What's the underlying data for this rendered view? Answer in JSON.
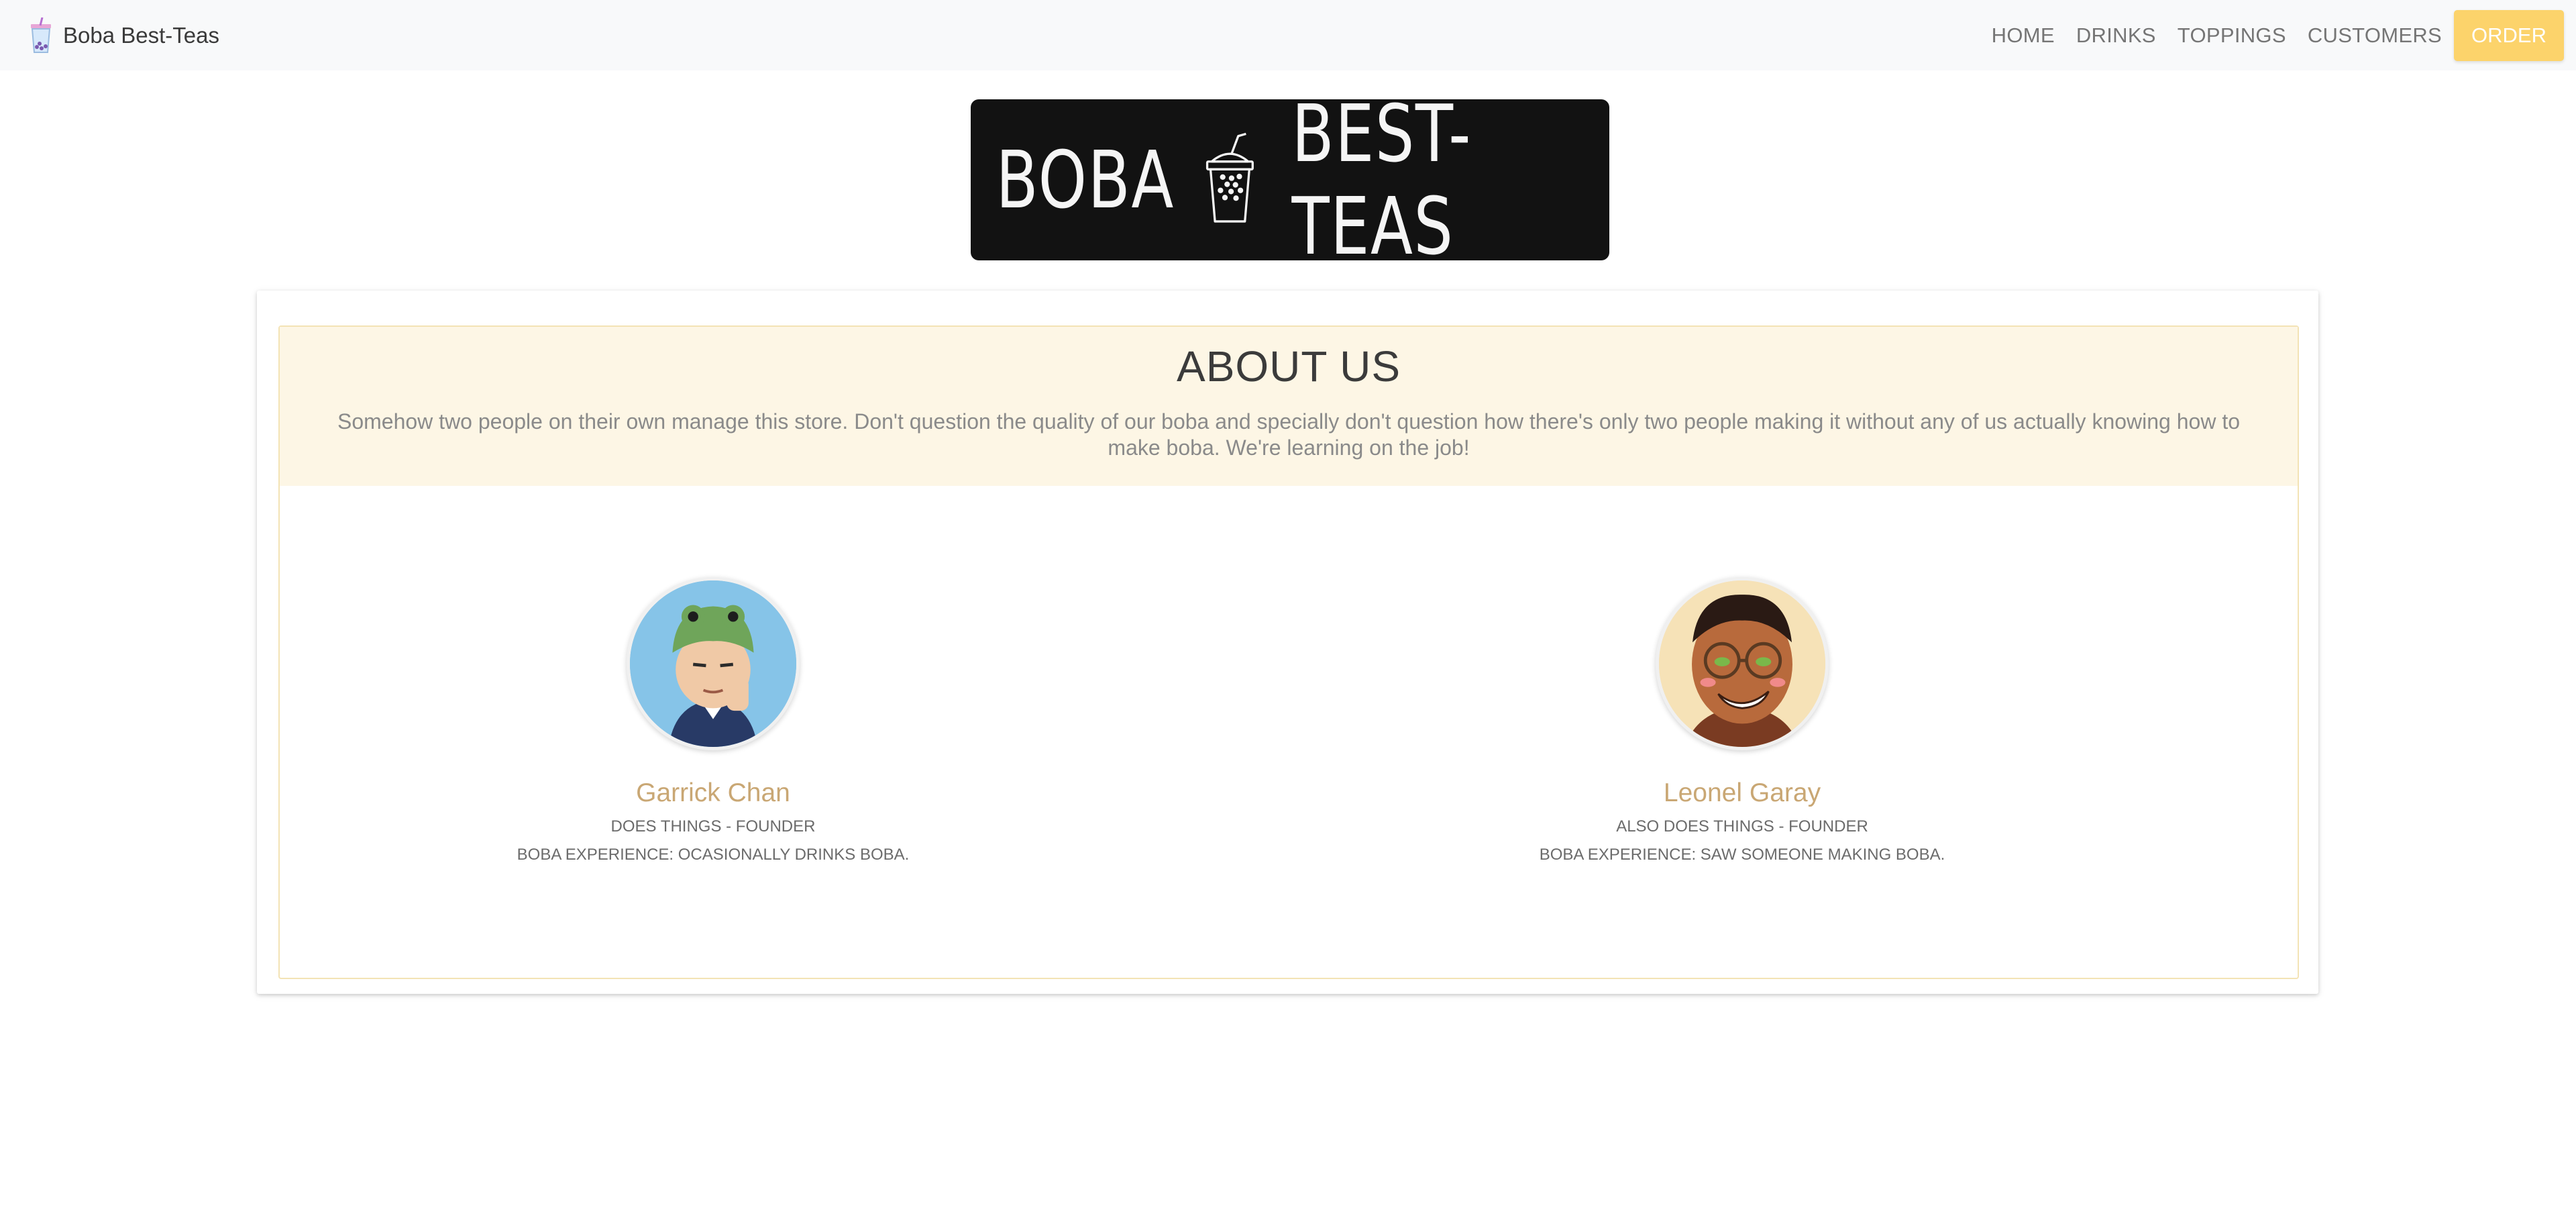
{
  "navbar": {
    "brand": "Boba Best-Teas",
    "brand_icon": "boba-cup-icon",
    "links": [
      "HOME",
      "DRINKS",
      "TOPPINGS",
      "CUSTOMERS"
    ],
    "order_label": "ORDER",
    "order_color": "#fcd36b"
  },
  "logo": {
    "left_word": "BOBA",
    "right_word": "BEST-TEAS",
    "icon": "boba-cup-icon"
  },
  "about": {
    "title": "ABOUT US",
    "description": "Somehow two people on their own manage this store. Don't question the quality of our boba and specially don't question how there's only two people making it without any of us actually knowing how to make boba. We're learning on the job!",
    "header_bg": "#fdf6e5"
  },
  "team": [
    {
      "name": "Garrick Chan",
      "role": "DOES THINGS - FOUNDER",
      "experience": "BOBA EXPERIENCE: OCASIONALLY DRINKS BOBA.",
      "avatar": "frog-hat-avatar"
    },
    {
      "name": "Leonel Garay",
      "role": "ALSO DOES THINGS - FOUNDER",
      "experience": "BOBA EXPERIENCE: SAW SOMEONE MAKING BOBA.",
      "avatar": "glasses-avatar"
    }
  ],
  "colors": {
    "accent": "#c9a774",
    "navbar_bg": "#f8f9fa"
  }
}
